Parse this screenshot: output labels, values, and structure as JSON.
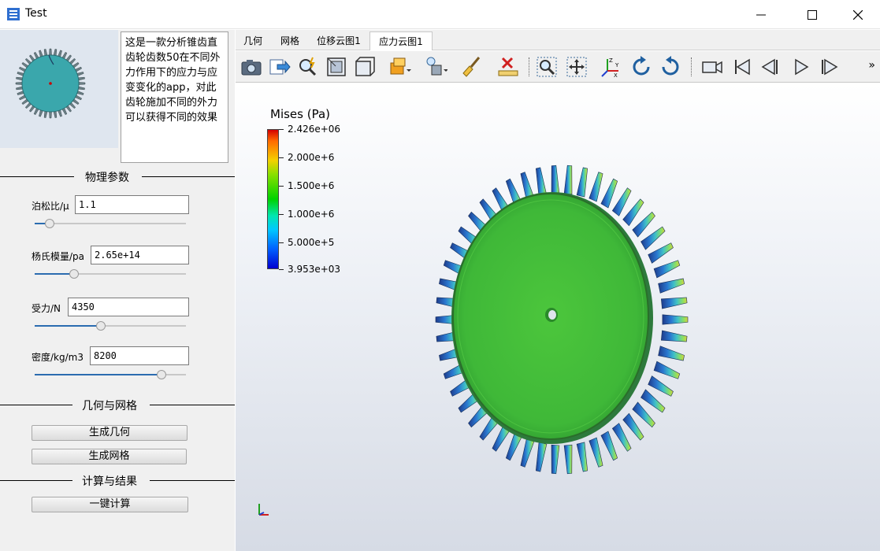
{
  "window": {
    "title": "Test",
    "controls": [
      "minimize-icon",
      "maximize-icon",
      "close-icon"
    ]
  },
  "description": "这是一款分析锥齿直齿轮齿数50在不同外力作用下的应力与应变变化的app，对此齿轮施加不同的外力可以获得不同的效果",
  "sections": {
    "physics": "物理参数",
    "geometry": "几何与网格",
    "compute": "计算与结果"
  },
  "params": [
    {
      "label": "泊松比/μ",
      "value": "1.1",
      "slider": 0.1
    },
    {
      "label": "杨氏模量/pa",
      "value": "2.65e+14",
      "slider": 0.26
    },
    {
      "label": "受力/N",
      "value": "4350",
      "slider": 0.44
    },
    {
      "label": "密度/kg/m3",
      "value": "8200",
      "slider": 0.84
    }
  ],
  "buttons": {
    "gen_geometry": "生成几何",
    "gen_mesh": "生成网格",
    "compute": "一键计算"
  },
  "tabs": [
    {
      "label": "几何",
      "active": false
    },
    {
      "label": "网格",
      "active": false
    },
    {
      "label": "位移云图1",
      "active": false
    },
    {
      "label": "应力云图1",
      "active": true
    }
  ],
  "toolbar_icons": [
    "camera-icon",
    "export-icon",
    "zoom-probe-icon",
    "view-frame-icon",
    "box-view-icon",
    "color-box-icon",
    "light-cube-icon",
    "brush-icon",
    "ruler-icon",
    "zoom-box-icon",
    "fit-icon",
    "axes-icon",
    "rotate-cw-icon",
    "rotate-ccw-icon",
    "video-icon",
    "first-frame-icon",
    "prev-frame-icon",
    "play-icon",
    "last-frame-icon"
  ],
  "toolbar_more": "»",
  "legend": {
    "title": "Mises (Pa)",
    "labels": [
      "2.426e+06",
      "2.000e+6",
      "1.500e+6",
      "1.000e+6",
      "5.000e+5",
      "3.953e+03"
    ]
  }
}
